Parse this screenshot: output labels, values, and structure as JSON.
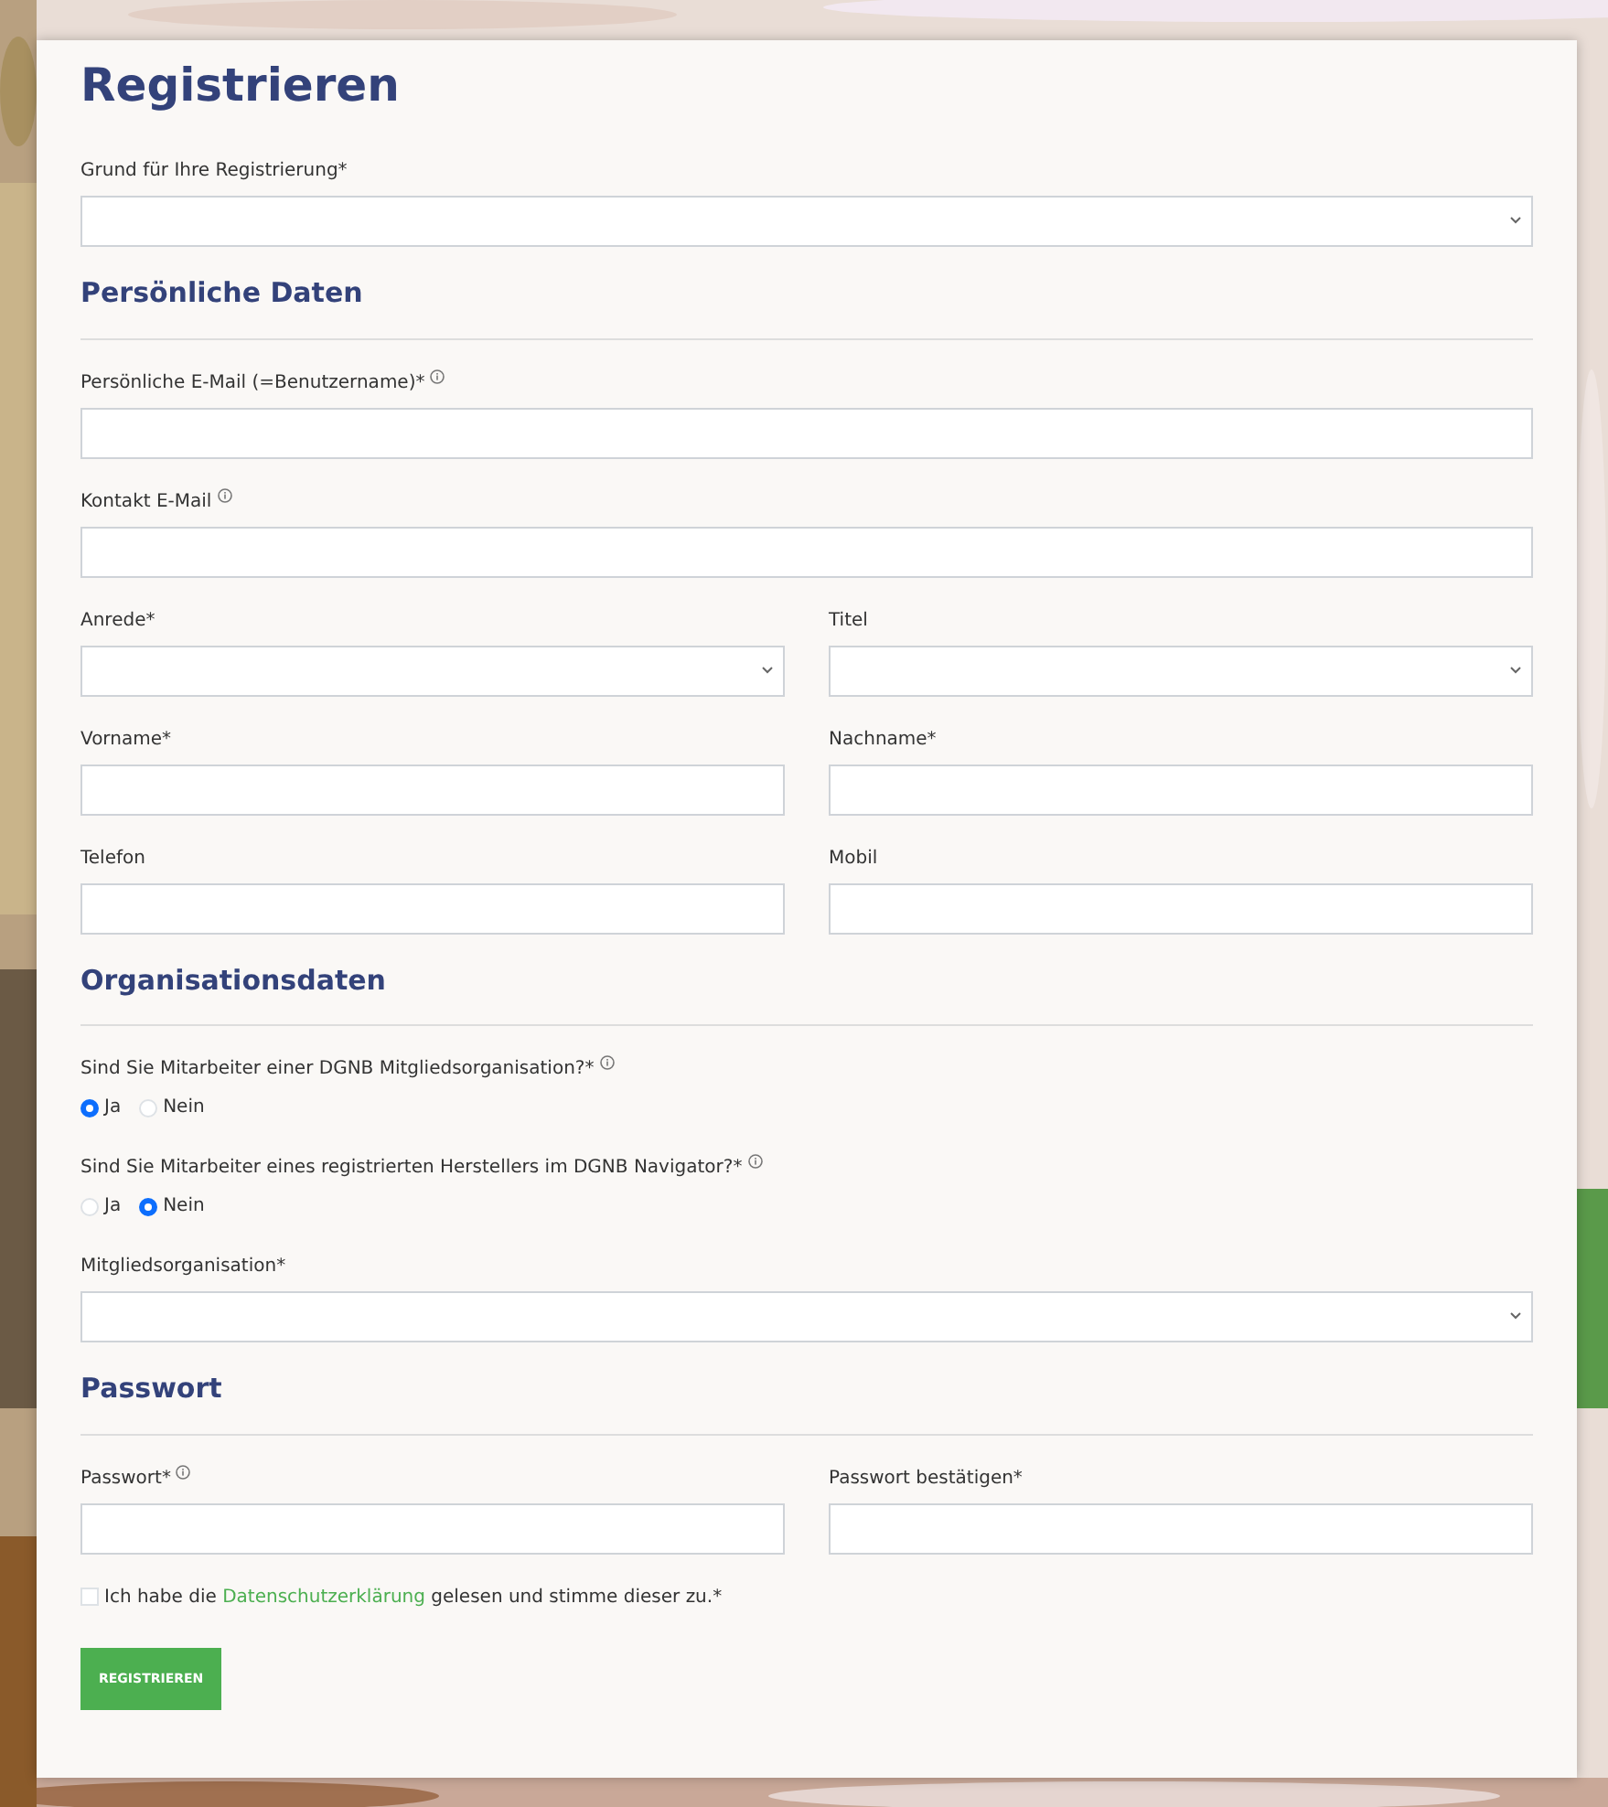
{
  "title": "Registrieren",
  "reason": {
    "label": "Grund für Ihre Registrierung*",
    "kind": "select",
    "info": false
  },
  "sections": [
    {
      "heading": "Persönliche Daten",
      "items": [
        {
          "kind": "fields",
          "fields": [
            {
              "label": "Persönliche E-Mail (=Benutzername)*",
              "kind": "input",
              "info": true
            }
          ]
        },
        {
          "kind": "fields",
          "fields": [
            {
              "label": "Kontakt E-Mail",
              "kind": "input",
              "info": true
            }
          ]
        },
        {
          "kind": "fields",
          "fields": [
            {
              "label": "Anrede*",
              "kind": "select",
              "info": false
            },
            {
              "label": "Titel",
              "kind": "select",
              "info": false
            }
          ]
        },
        {
          "kind": "fields",
          "fields": [
            {
              "label": "Vorname*",
              "kind": "input",
              "info": false
            },
            {
              "label": "Nachname*",
              "kind": "input",
              "info": false
            }
          ]
        },
        {
          "kind": "fields",
          "fields": [
            {
              "label": "Telefon",
              "kind": "input",
              "info": false
            },
            {
              "label": "Mobil",
              "kind": "input",
              "info": false
            }
          ]
        }
      ]
    },
    {
      "heading": "Organisationsdaten",
      "items": [
        {
          "kind": "radio",
          "label": "Sind Sie Mitarbeiter einer DGNB Mitgliedsorganisation?*",
          "info": true,
          "options": [
            {
              "label": "Ja",
              "selected": true
            },
            {
              "label": "Nein",
              "selected": false
            }
          ]
        },
        {
          "kind": "radio",
          "label": "Sind Sie Mitarbeiter eines registrierten Herstellers im DGNB Navigator?*",
          "info": true,
          "options": [
            {
              "label": "Ja",
              "selected": false
            },
            {
              "label": "Nein",
              "selected": true
            }
          ]
        },
        {
          "kind": "fields",
          "fields": [
            {
              "label": "Mitgliedsorganisation*",
              "kind": "select",
              "info": false
            }
          ]
        }
      ]
    },
    {
      "heading": "Passwort",
      "items": [
        {
          "kind": "fields",
          "fields": [
            {
              "label": "Passwort*",
              "kind": "input",
              "info": true
            },
            {
              "label": "Passwort bestätigen*",
              "kind": "input",
              "info": false
            }
          ]
        },
        {
          "kind": "checkbox",
          "checked": false,
          "before": "Ich habe die",
          "link": "Datenschutzerklärung",
          "after": "gelesen und stimme dieser zu.*"
        }
      ]
    }
  ],
  "submit": "REGISTRIEREN"
}
